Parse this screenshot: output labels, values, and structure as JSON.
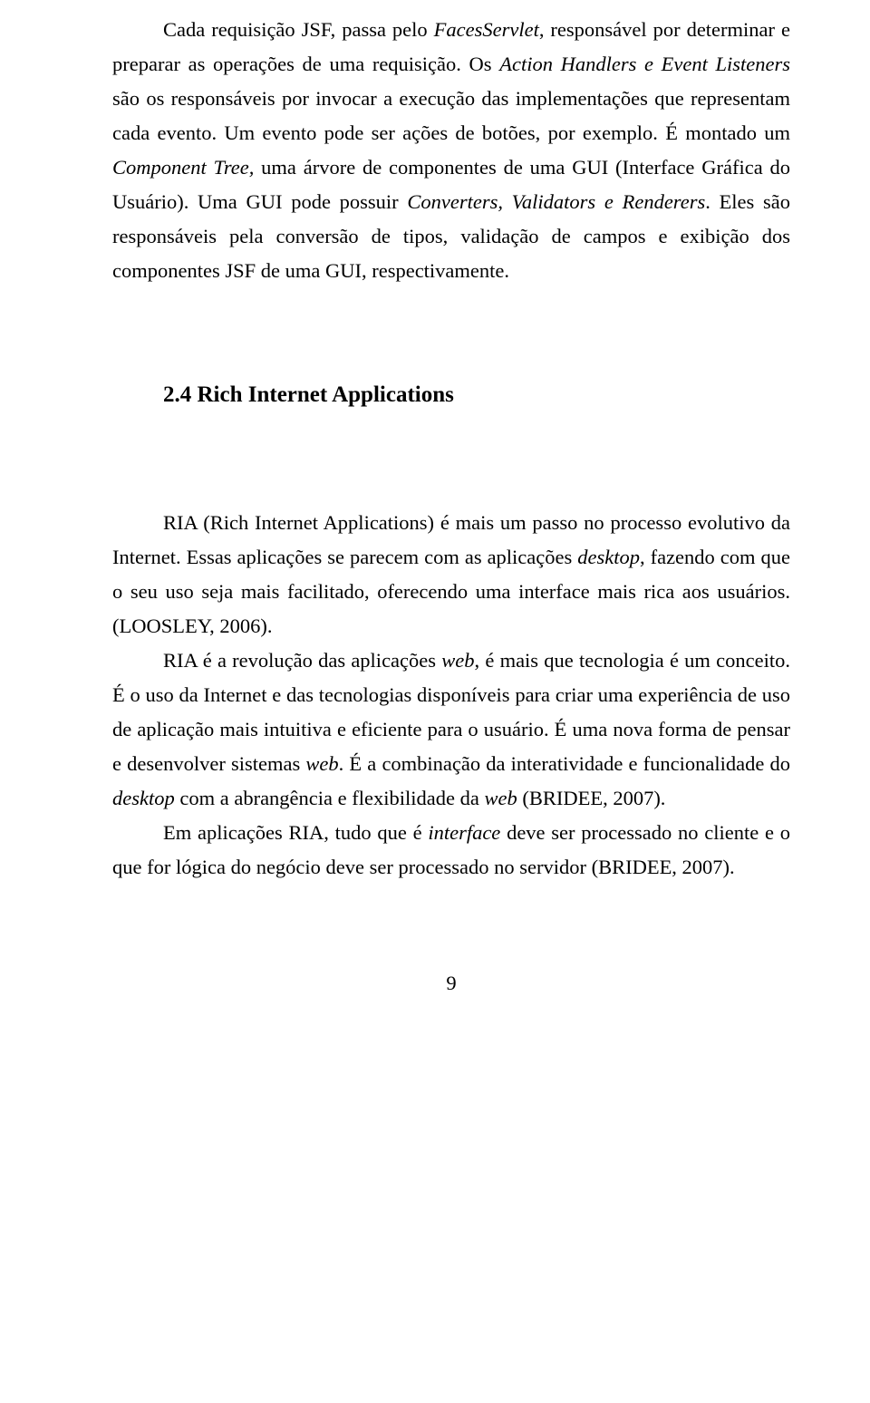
{
  "p1": {
    "t0": "Cada requisição JSF, passa pelo ",
    "i1": "FacesServlet",
    "t2": ", responsável por determinar e preparar as operações de uma requisição. Os ",
    "i3": "Action Handlers e Event Listeners",
    "t4": " são os responsáveis por invocar a execução das implementações que representam cada evento. Um evento pode ser ações de botões, por exemplo. É montado um ",
    "i5": "Component Tree,",
    "t6": " uma árvore de componentes de uma GUI (Interface Gráfica do Usuário). Uma GUI pode possuir ",
    "i7": "Converters, Validators e Renderers",
    "t8": ". Eles são responsáveis pela conversão de tipos, validação de campos e exibição dos componentes JSF de uma GUI, respectivamente."
  },
  "heading": "2.4 Rich Internet Applications",
  "p2": {
    "t0": "RIA (Rich Internet Applications) é mais um passo no processo evolutivo da Internet. Essas aplicações se parecem com as aplicações ",
    "i1": "desktop",
    "t2": ", fazendo com que o seu uso seja mais facilitado, oferecendo uma interface mais rica aos usuários. (LOOSLEY, 2006)."
  },
  "p3": {
    "t0": "RIA é a revolução das aplicações ",
    "i1": "web",
    "t2": ", é mais que tecnologia é um conceito. É o uso da Internet e das tecnologias disponíveis para criar uma experiência de uso de aplicação mais intuitiva e eficiente para o usuário. É uma nova forma de pensar e desenvolver sistemas ",
    "i3": "web",
    "t4": ". É a combinação da interatividade e funcionalidade do ",
    "i5": "desktop",
    "t6": " com a abrangência e flexibilidade da ",
    "i7": "web",
    "t8": " (BRIDEE, 2007)."
  },
  "p4": {
    "t0": "Em aplicações RIA, tudo que é ",
    "i1": "interface",
    "t2": " deve ser processado no cliente e o que for lógica do negócio deve ser processado no servidor (BRIDEE, 2007)."
  },
  "pageNumber": "9"
}
